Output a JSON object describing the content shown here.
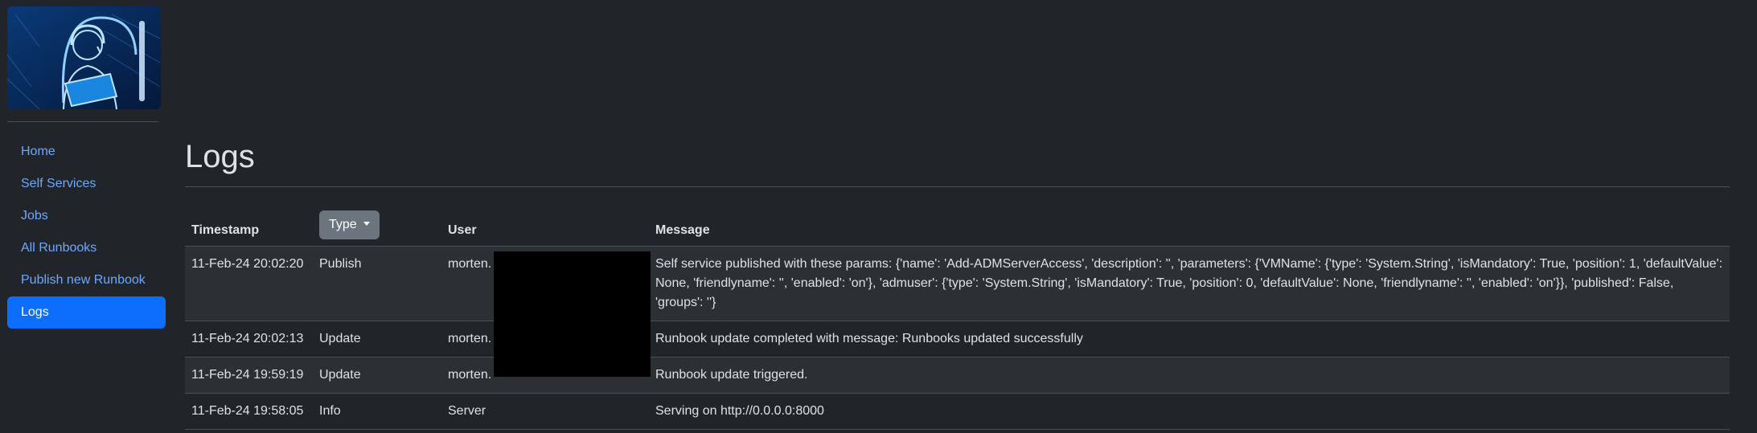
{
  "sidebar": {
    "logo_icon": "support-agent-illustration",
    "items": [
      {
        "label": "Home"
      },
      {
        "label": "Self Services"
      },
      {
        "label": "Jobs"
      },
      {
        "label": "All Runbooks"
      },
      {
        "label": "Publish new Runbook"
      },
      {
        "label": "Logs",
        "active": true
      }
    ]
  },
  "page": {
    "title": "Logs"
  },
  "table": {
    "headers": {
      "timestamp": "Timestamp",
      "type": "Type",
      "user": "User",
      "message": "Message"
    },
    "rows": [
      {
        "timestamp": "11-Feb-24 20:02:20",
        "type": "Publish",
        "user": "morten.",
        "message": "Self service published with these params: {'name': 'Add-ADMServerAccess', 'description': '', 'parameters': {'VMName': {'type': 'System.String', 'isMandatory': True, 'position': 1, 'defaultValue': None, 'friendlyname': '', 'enabled': 'on'}, 'admuser': {'type': 'System.String', 'isMandatory': True, 'position': 0, 'defaultValue': None, 'friendlyname': '', 'enabled': 'on'}}, 'published': False, 'groups': ''}"
      },
      {
        "timestamp": "11-Feb-24 20:02:13",
        "type": "Update",
        "user": "morten.",
        "message": "Runbook update completed with message: Runbooks updated successfully"
      },
      {
        "timestamp": "11-Feb-24 19:59:19",
        "type": "Update",
        "user": "morten.",
        "message": "Runbook update triggered."
      },
      {
        "timestamp": "11-Feb-24 19:58:05",
        "type": "Info",
        "user": "Server",
        "message": "Serving on http://0.0.0.0:8000"
      }
    ]
  },
  "colors": {
    "background": "#212529",
    "accent": "#0d6efd",
    "link": "#6ea8fe",
    "button": "#6c757d",
    "stripe": "#2c3034",
    "redaction": "#000000"
  }
}
